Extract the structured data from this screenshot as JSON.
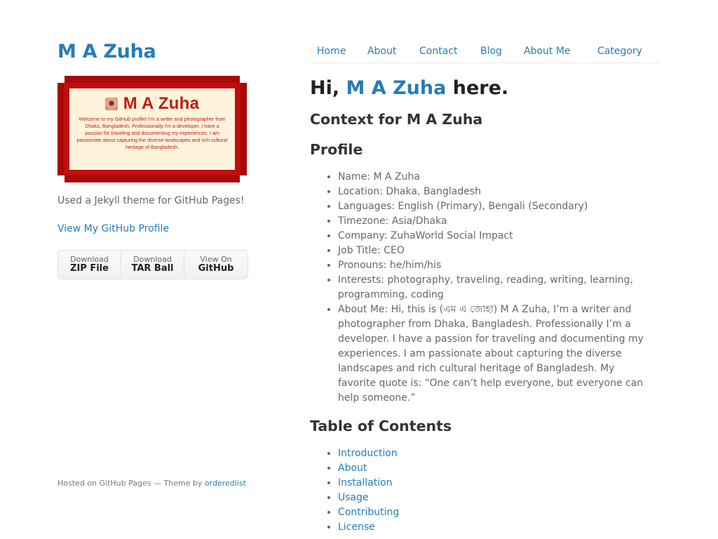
{
  "sidebar": {
    "site_title": "M A Zuha",
    "banner": {
      "title": "M A Zuha",
      "text": "Welcome to my GitHub profile! I'm a writer and photographer from Dhaka, Bangladesh. Professionally I'm a developer. I have a passion for traveling and documenting my experiences. I am passionate about capturing the diverse landscapes and rich cultural heritage of Bangladesh."
    },
    "tagline": "Used a Jekyll theme for GitHub Pages!",
    "profile_link": "View My GitHub Profile",
    "downloads": [
      {
        "small": "Download",
        "big": "ZIP File"
      },
      {
        "small": "Download",
        "big": "TAR Ball"
      },
      {
        "small": "View On",
        "big": "GitHub"
      }
    ],
    "footer": {
      "prefix": "Hosted on GitHub Pages — Theme by ",
      "link": "orderedlist"
    }
  },
  "nav": {
    "items": [
      "Home",
      "About",
      "Contact",
      "Blog",
      "About Me",
      "Category"
    ]
  },
  "main": {
    "greeting": {
      "pre": "Hi, ",
      "name": "M A Zuha",
      "post": " here."
    },
    "context_heading": "Context for M A Zuha",
    "profile_heading": "Profile",
    "profile_items": [
      "Name: M A Zuha",
      "Location: Dhaka, Bangladesh",
      "Languages: English (Primary), Bengali (Secondary)",
      "Timezone: Asia/Dhaka",
      "Company: ZuhaWorld Social Impact",
      "Job Title: CEO",
      "Pronouns: he/him/his",
      "Interests: photography, traveling, reading, writing, learning, programming, coding",
      "About Me: Hi, this is (এম এ জোহা) M A Zuha, I’m a writer and photographer from Dhaka, Bangladesh. Professionally I’m a developer. I have a passion for traveling and documenting my experiences. I am passionate about capturing the diverse landscapes and rich cultural heritage of Bangladesh. My favorite quote is: “One can’t help everyone, but everyone can help someone.”"
    ],
    "toc_heading": "Table of Contents",
    "toc_items": [
      "Introduction",
      "About",
      "Installation",
      "Usage",
      "Contributing",
      "License"
    ]
  },
  "colors": {
    "link": "#267CB9",
    "heading": "#222222",
    "text": "#676767",
    "banner_red": "#A70A08",
    "banner_card": "#FFF3DC"
  }
}
